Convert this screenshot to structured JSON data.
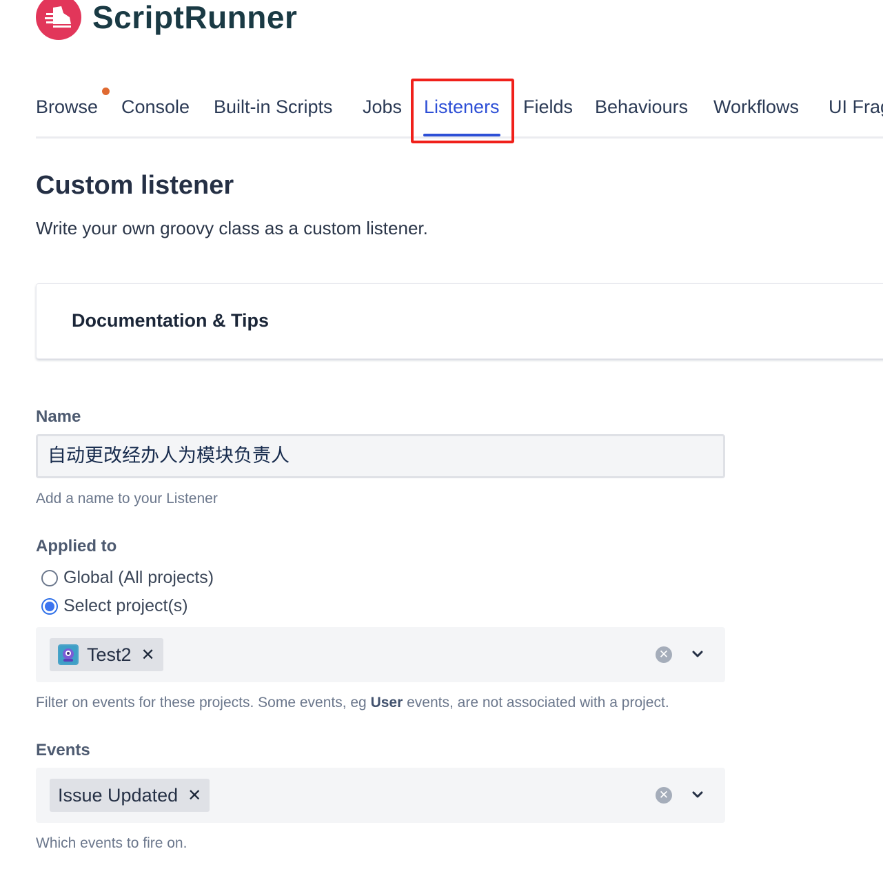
{
  "app": {
    "name": "ScriptRunner"
  },
  "tabs": [
    {
      "label": "Browse",
      "active": false,
      "has_notification": true
    },
    {
      "label": "Console",
      "active": false
    },
    {
      "label": "Built-in Scripts",
      "active": false
    },
    {
      "label": "Jobs",
      "active": false
    },
    {
      "label": "Listeners",
      "active": true
    },
    {
      "label": "Fields",
      "active": false
    },
    {
      "label": "Behaviours",
      "active": false
    },
    {
      "label": "Workflows",
      "active": false
    },
    {
      "label": "UI Frag",
      "active": false
    }
  ],
  "page": {
    "title": "Custom listener",
    "subtitle": "Write your own groovy class as a custom listener."
  },
  "doc_card": {
    "label": "Documentation & Tips"
  },
  "form": {
    "name": {
      "label": "Name",
      "value": "自动更改经办人为模块负责人",
      "help": "Add a name to your Listener"
    },
    "applied_to": {
      "label": "Applied to",
      "options": [
        {
          "label": "Global (All projects)",
          "selected": false
        },
        {
          "label": "Select project(s)",
          "selected": true
        }
      ],
      "selected_projects": [
        "Test2"
      ],
      "help_prefix": "Filter on events for these projects. Some events, eg ",
      "help_bold": "User",
      "help_suffix": " events, are not associated with a project."
    },
    "events": {
      "label": "Events",
      "selected": [
        "Issue Updated"
      ],
      "help": "Which events to fire on."
    }
  },
  "colors": {
    "accent": "#2d4fd6",
    "logo": "#e2365a",
    "highlight": "#f0201a",
    "notification": "#e06a31"
  },
  "icons": {
    "logo": "running-shoe-icon",
    "project_avatar": "project-avatar-icon",
    "chip_remove": "close-icon",
    "clear": "clear-circle-icon",
    "dropdown": "chevron-down-icon"
  }
}
